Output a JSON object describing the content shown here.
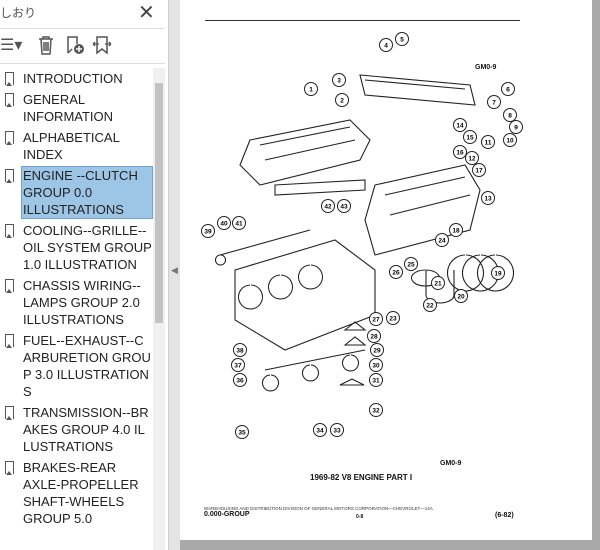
{
  "panel": {
    "title": "しおり",
    "close": "✕"
  },
  "toolbar": {
    "options": "☰▾",
    "delete": "🗑",
    "add": "add-bookmark",
    "expand": "expand-bookmark"
  },
  "bookmarks": [
    {
      "label": "INTRODUCTION"
    },
    {
      "label": "GENERAL INFORMATION"
    },
    {
      "label": "ALPHABETICAL INDEX"
    },
    {
      "label": "ENGINE --CLUTCH GROUP 0.0 ILLUSTRATIONS",
      "selected": true
    },
    {
      "label": "COOLING--GRILLE--OIL SYSTEM GROUP 1.0 ILLUSTRATION"
    },
    {
      "label": "CHASSIS WIRING--LAMPS GROUP 2.0 ILLUSTRATIONS"
    },
    {
      "label": "FUEL--EXHAUST--CARBURETION GROUP 3.0 ILLUSTRATIONS"
    },
    {
      "label": "TRANSMISSION--BRAKES GROUP 4.0 ILLUSTRATIONS"
    },
    {
      "label": "BRAKES-REAR AXLE-PROPELLER SHAFT-WHEELS GROUP 5.0"
    }
  ],
  "page": {
    "code_top": "GM0-9",
    "code_bottom": "GM0-9",
    "caption": "1969-82 V8 ENGINE PART I",
    "footer_line": "WAREHOUSING AND DISTRIBUTION DIVISION OF GENERAL MOTORS CORPORATION—CHEVROLET—14A",
    "group": "0.000-GROUP",
    "page_no": "0-8",
    "date": "(6-82)",
    "callouts": [
      "1",
      "2",
      "3",
      "4",
      "5",
      "6",
      "7",
      "8",
      "9",
      "10",
      "11",
      "12",
      "13",
      "14",
      "15",
      "16",
      "17",
      "18",
      "19",
      "20",
      "21",
      "22",
      "23",
      "24",
      "25",
      "26",
      "27",
      "28",
      "29",
      "30",
      "31",
      "32",
      "33",
      "34",
      "35",
      "36",
      "37",
      "38",
      "39",
      "40",
      "41",
      "42",
      "43"
    ]
  }
}
